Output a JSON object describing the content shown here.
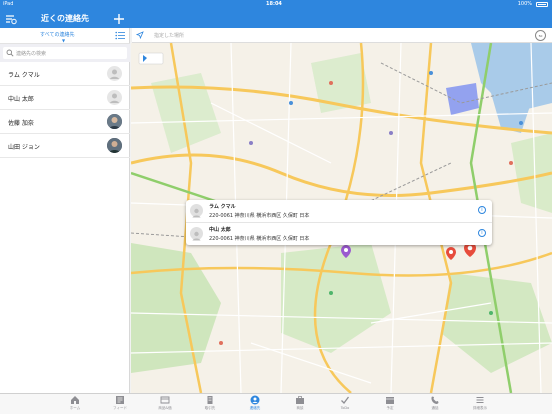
{
  "status_bar": {
    "carrier": "iPad",
    "time": "18:04",
    "battery": "100%"
  },
  "nav": {
    "title": "近くの連絡先",
    "filter_icon": "filter-icon",
    "add_icon": "plus-icon"
  },
  "sidebar": {
    "segment_label": "すべての連絡先",
    "search_placeholder": "連絡先の検索",
    "contacts": [
      {
        "name": "ラム クマル",
        "avatar": "placeholder"
      },
      {
        "name": "中山 太郎",
        "avatar": "placeholder"
      },
      {
        "name": "佐藤 加奈",
        "avatar": "photo"
      },
      {
        "name": "山田 ジョン",
        "avatar": "photo"
      }
    ]
  },
  "map": {
    "search_placeholder": "指定した場所",
    "zoom_badge": "50 km",
    "callout": [
      {
        "name": "ラム クマル",
        "address": "220-0061 神奈川県 横浜市西区 久保町 日本"
      },
      {
        "name": "中山 太郎",
        "address": "220-0061 神奈川県 横浜市西区 久保町 日本"
      }
    ]
  },
  "tabs": [
    {
      "label": "ホーム",
      "icon": "home-icon"
    },
    {
      "label": "フィード",
      "icon": "feed-icon"
    },
    {
      "label": "商品&価",
      "icon": "catalog-icon"
    },
    {
      "label": "取引先",
      "icon": "account-icon"
    },
    {
      "label": "連絡先",
      "icon": "contact-icon",
      "active": true
    },
    {
      "label": "商談",
      "icon": "deal-icon"
    },
    {
      "label": "ToDo",
      "icon": "check-icon"
    },
    {
      "label": "予定",
      "icon": "calendar-icon"
    },
    {
      "label": "通話",
      "icon": "phone-icon"
    },
    {
      "label": "詳細表示",
      "icon": "more-icon"
    }
  ],
  "colors": {
    "accent": "#2e86de",
    "map_bg": "#f5f1e8",
    "road": "#f7c85b",
    "water": "#a9cbe9"
  }
}
